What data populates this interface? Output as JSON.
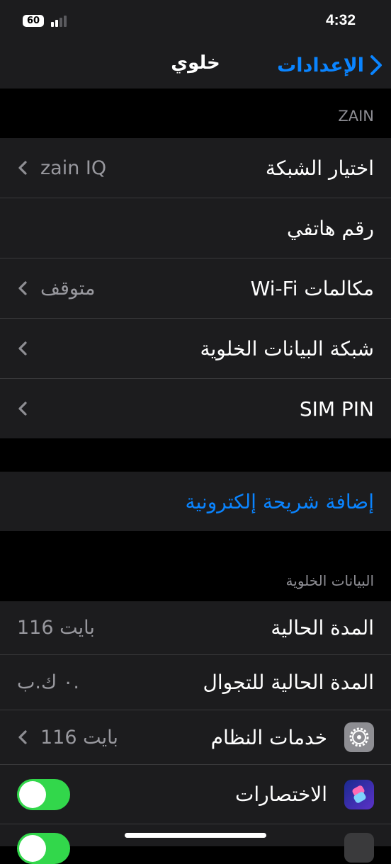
{
  "status_bar": {
    "battery": "60",
    "time": "4:32"
  },
  "nav": {
    "back_label": "الإعدادات",
    "title": "خلوي"
  },
  "carrier_section": {
    "header": "ZAIN",
    "rows": [
      {
        "label": "اختيار الشبكة",
        "value": "zain IQ"
      },
      {
        "label": "رقم هاتفي"
      },
      {
        "label": "مكالمات Wi-Fi",
        "value": "متوقف"
      },
      {
        "label": "شبكة البيانات الخلوية"
      },
      {
        "label": "SIM PIN"
      }
    ]
  },
  "esim": {
    "add_label": "إضافة شريحة إلكترونية"
  },
  "cellular_data": {
    "header": "البيانات الخلوية",
    "current_period": {
      "label": "المدة الحالية",
      "value": "116 بايت"
    },
    "current_roaming": {
      "label": "المدة الحالية للتجوال",
      "value": "٠ ك.ب."
    },
    "system_services": {
      "label": "خدمات النظام",
      "value": "116 بايت",
      "icon": "gear-icon"
    },
    "shortcuts": {
      "label": "الاختصارات",
      "icon": "shortcuts-icon",
      "toggle_on": true
    }
  },
  "colors": {
    "accent": "#0a84ff",
    "toggle_on": "#32d74b",
    "cell_bg": "#1c1c1e",
    "secondary_text": "#98989e"
  }
}
